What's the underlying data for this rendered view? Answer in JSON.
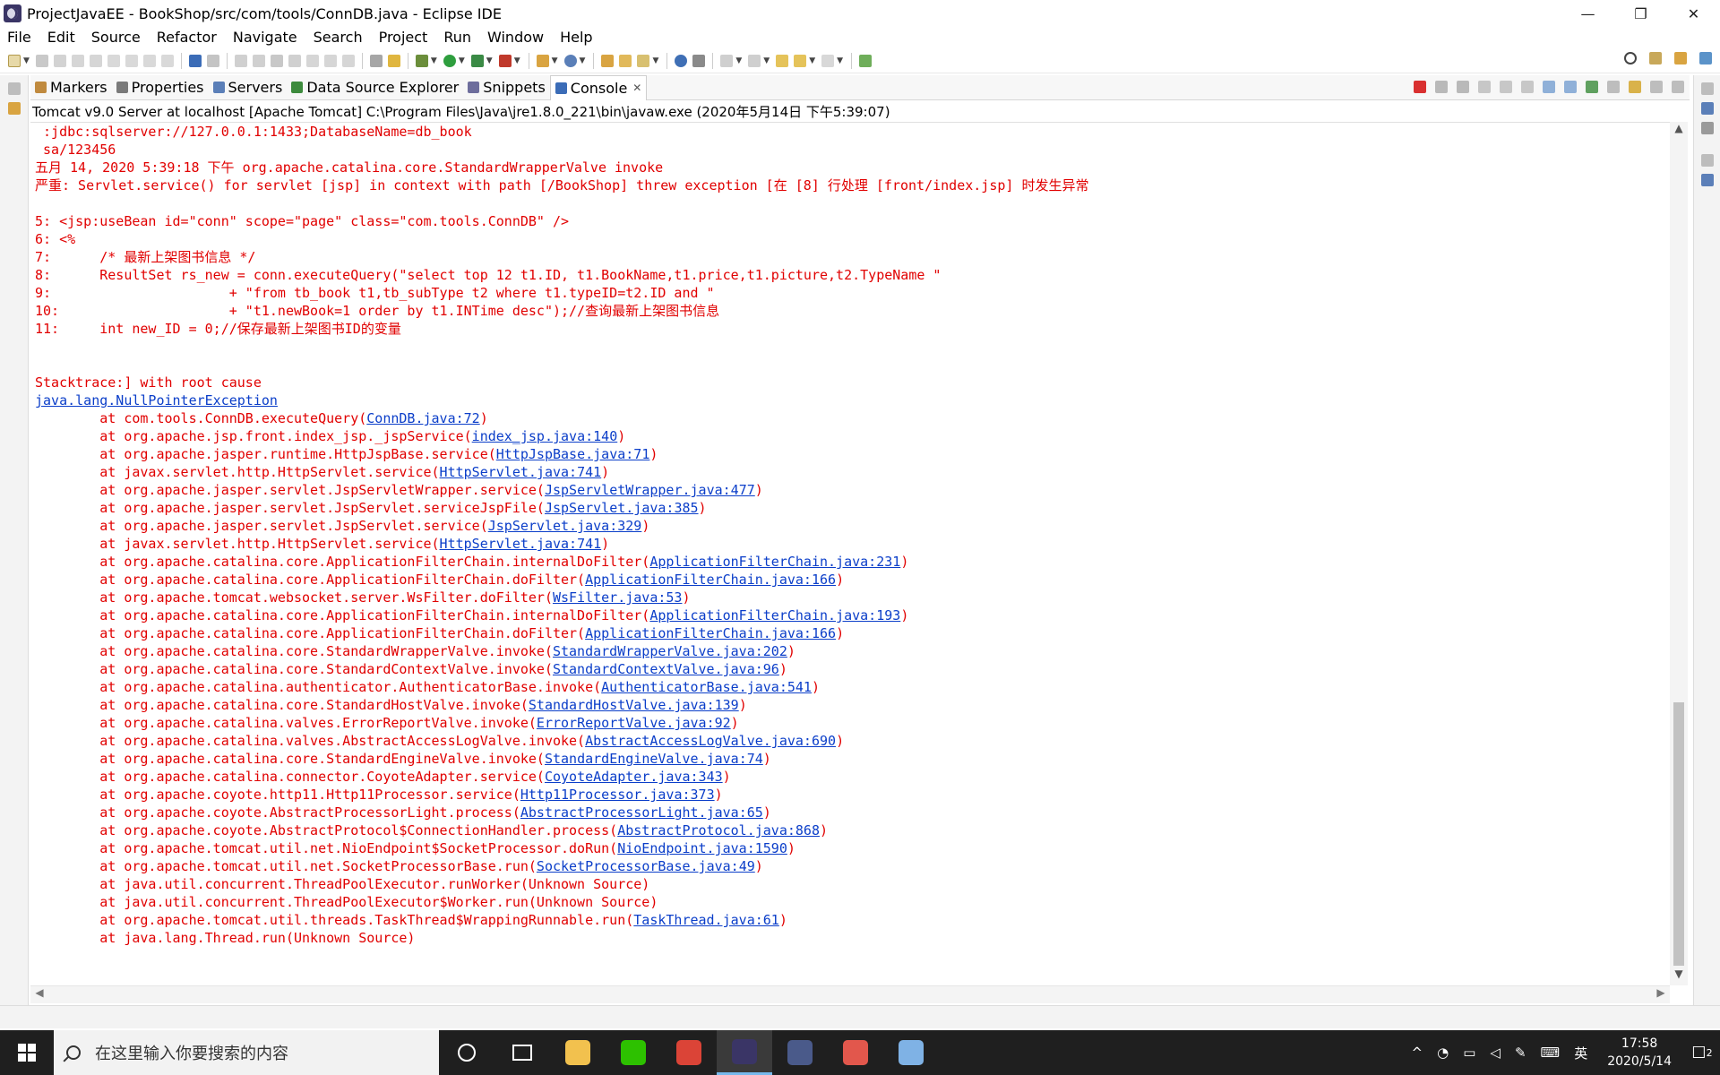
{
  "window": {
    "title": "ProjectJavaEE - BookShop/src/com/tools/ConnDB.java - Eclipse IDE",
    "minimize": "—",
    "maximize": "❐",
    "close": "✕"
  },
  "menu": [
    "File",
    "Edit",
    "Source",
    "Refactor",
    "Navigate",
    "Search",
    "Project",
    "Run",
    "Window",
    "Help"
  ],
  "tabs": [
    {
      "label": "Markers",
      "color": "#c08a3e"
    },
    {
      "label": "Properties",
      "color": "#7a7a7a"
    },
    {
      "label": "Servers",
      "color": "#5b7fb8"
    },
    {
      "label": "Data Source Explorer",
      "color": "#3d8b3d"
    },
    {
      "label": "Snippets",
      "color": "#6d6d9c"
    },
    {
      "label": "Console",
      "color": "#3b6cb7",
      "active": true
    }
  ],
  "tab_close": "✕",
  "console": {
    "header": "Tomcat v9.0 Server at localhost [Apache Tomcat] C:\\Program Files\\Java\\jre1.8.0_221\\bin\\javaw.exe  (2020年5月14日 下午5:39:07)",
    "lines": [
      {
        "text": " :jdbc:sqlserver://127.0.0.1:1433;DatabaseName=db_book"
      },
      {
        "text": " sa/123456"
      },
      {
        "text": "五月 14, 2020 5:39:18 下午 org.apache.catalina.core.StandardWrapperValve invoke"
      },
      {
        "text": "严重: Servlet.service() for servlet [jsp] in context with path [/BookShop] threw exception [在 [8] 行处理 [front/index.jsp] 时发生异常"
      },
      {
        "text": ""
      },
      {
        "text": "5: <jsp:useBean id=\"conn\" scope=\"page\" class=\"com.tools.ConnDB\" />"
      },
      {
        "text": "6: <%"
      },
      {
        "text": "7:      /* 最新上架图书信息 */"
      },
      {
        "text": "8:      ResultSet rs_new = conn.executeQuery(\"select top 12 t1.ID, t1.BookName,t1.price,t1.picture,t2.TypeName \""
      },
      {
        "text": "9:                      + \"from tb_book t1,tb_subType t2 where t1.typeID=t2.ID and \""
      },
      {
        "text": "10:                     + \"t1.newBook=1 order by t1.INTime desc\");//查询最新上架图书信息"
      },
      {
        "text": "11:     int new_ID = 0;//保存最新上架图书ID的变量"
      },
      {
        "text": ""
      },
      {
        "text": ""
      },
      {
        "text": "Stacktrace:] with root cause"
      },
      {
        "text": "",
        "link": "java.lang.NullPointerException",
        "after": ""
      },
      {
        "text": "\tat com.tools.ConnDB.executeQuery(",
        "link": "ConnDB.java:72",
        "after": ")"
      },
      {
        "text": "\tat org.apache.jsp.front.index_jsp._jspService(",
        "link": "index_jsp.java:140",
        "after": ")"
      },
      {
        "text": "\tat org.apache.jasper.runtime.HttpJspBase.service(",
        "link": "HttpJspBase.java:71",
        "after": ")"
      },
      {
        "text": "\tat javax.servlet.http.HttpServlet.service(",
        "link": "HttpServlet.java:741",
        "after": ")"
      },
      {
        "text": "\tat org.apache.jasper.servlet.JspServletWrapper.service(",
        "link": "JspServletWrapper.java:477",
        "after": ")"
      },
      {
        "text": "\tat org.apache.jasper.servlet.JspServlet.serviceJspFile(",
        "link": "JspServlet.java:385",
        "after": ")"
      },
      {
        "text": "\tat org.apache.jasper.servlet.JspServlet.service(",
        "link": "JspServlet.java:329",
        "after": ")"
      },
      {
        "text": "\tat javax.servlet.http.HttpServlet.service(",
        "link": "HttpServlet.java:741",
        "after": ")"
      },
      {
        "text": "\tat org.apache.catalina.core.ApplicationFilterChain.internalDoFilter(",
        "link": "ApplicationFilterChain.java:231",
        "after": ")"
      },
      {
        "text": "\tat org.apache.catalina.core.ApplicationFilterChain.doFilter(",
        "link": "ApplicationFilterChain.java:166",
        "after": ")"
      },
      {
        "text": "\tat org.apache.tomcat.websocket.server.WsFilter.doFilter(",
        "link": "WsFilter.java:53",
        "after": ")"
      },
      {
        "text": "\tat org.apache.catalina.core.ApplicationFilterChain.internalDoFilter(",
        "link": "ApplicationFilterChain.java:193",
        "after": ")"
      },
      {
        "text": "\tat org.apache.catalina.core.ApplicationFilterChain.doFilter(",
        "link": "ApplicationFilterChain.java:166",
        "after": ")"
      },
      {
        "text": "\tat org.apache.catalina.core.StandardWrapperValve.invoke(",
        "link": "StandardWrapperValve.java:202",
        "after": ")"
      },
      {
        "text": "\tat org.apache.catalina.core.StandardContextValve.invoke(",
        "link": "StandardContextValve.java:96",
        "after": ")"
      },
      {
        "text": "\tat org.apache.catalina.authenticator.AuthenticatorBase.invoke(",
        "link": "AuthenticatorBase.java:541",
        "after": ")"
      },
      {
        "text": "\tat org.apache.catalina.core.StandardHostValve.invoke(",
        "link": "StandardHostValve.java:139",
        "after": ")"
      },
      {
        "text": "\tat org.apache.catalina.valves.ErrorReportValve.invoke(",
        "link": "ErrorReportValve.java:92",
        "after": ")"
      },
      {
        "text": "\tat org.apache.catalina.valves.AbstractAccessLogValve.invoke(",
        "link": "AbstractAccessLogValve.java:690",
        "after": ")"
      },
      {
        "text": "\tat org.apache.catalina.core.StandardEngineValve.invoke(",
        "link": "StandardEngineValve.java:74",
        "after": ")"
      },
      {
        "text": "\tat org.apache.catalina.connector.CoyoteAdapter.service(",
        "link": "CoyoteAdapter.java:343",
        "after": ")"
      },
      {
        "text": "\tat org.apache.coyote.http11.Http11Processor.service(",
        "link": "Http11Processor.java:373",
        "after": ")"
      },
      {
        "text": "\tat org.apache.coyote.AbstractProcessorLight.process(",
        "link": "AbstractProcessorLight.java:65",
        "after": ")"
      },
      {
        "text": "\tat org.apache.coyote.AbstractProtocol$ConnectionHandler.process(",
        "link": "AbstractProtocol.java:868",
        "after": ")"
      },
      {
        "text": "\tat org.apache.tomcat.util.net.NioEndpoint$SocketProcessor.doRun(",
        "link": "NioEndpoint.java:1590",
        "after": ")"
      },
      {
        "text": "\tat org.apache.tomcat.util.net.SocketProcessorBase.run(",
        "link": "SocketProcessorBase.java:49",
        "after": ")"
      },
      {
        "text": "\tat java.util.concurrent.ThreadPoolExecutor.runWorker(Unknown Source)"
      },
      {
        "text": "\tat java.util.concurrent.ThreadPoolExecutor$Worker.run(Unknown Source)"
      },
      {
        "text": "\tat org.apache.tomcat.util.threads.TaskThread$WrappingRunnable.run(",
        "link": "TaskThread.java:61",
        "after": ")"
      },
      {
        "text": "\tat java.lang.Thread.run(Unknown Source)"
      }
    ]
  },
  "taskbar": {
    "search_placeholder": "在这里输入你要搜索的内容",
    "ime": "英",
    "time": "17:58",
    "date": "2020/5/14",
    "notification_count": "2",
    "apps": [
      {
        "name": "file-explorer-icon",
        "color": "#f2c14e"
      },
      {
        "name": "wechat-icon",
        "color": "#2dc100"
      },
      {
        "name": "chrome-icon",
        "color": "#db4437"
      },
      {
        "name": "eclipse-icon",
        "color": "#3a3566",
        "active": true
      },
      {
        "name": "calendar-app-icon",
        "color": "#4a5a8a"
      },
      {
        "name": "paint-app-icon",
        "color": "#e2574c"
      },
      {
        "name": "paintbrush-app-icon",
        "color": "#7fb2e5"
      }
    ]
  }
}
